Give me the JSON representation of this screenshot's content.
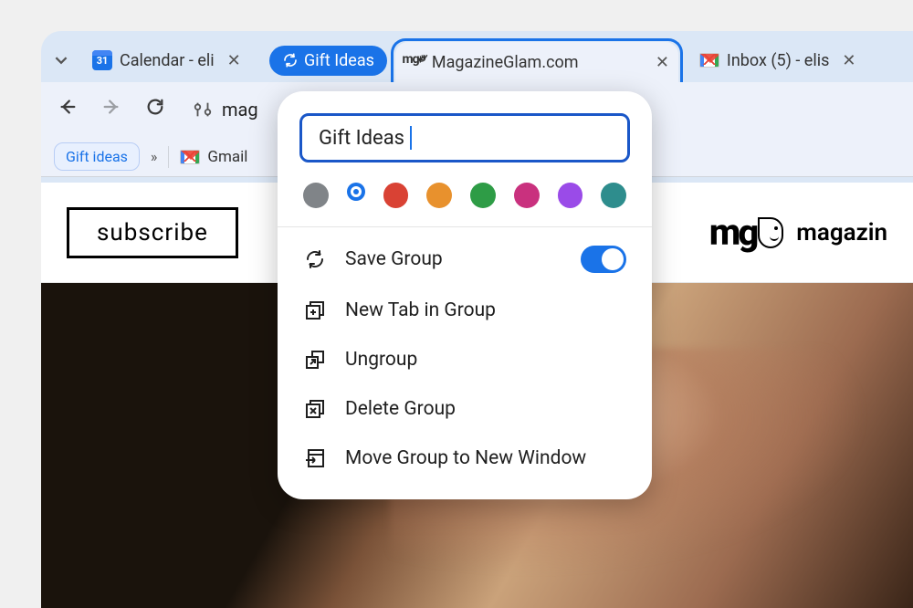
{
  "tabs": {
    "calendar_label": "Calendar - eli",
    "group_pill": "Gift Ideas",
    "magazine_label": "MagazineGlam.com",
    "inbox_label": "Inbox (5) - elis",
    "calendar_day": "31"
  },
  "toolbar": {
    "address_text": "mag"
  },
  "bookmarks": {
    "pill": "Gift ideas",
    "gmail_label": "Gmail"
  },
  "page": {
    "subscribe_label": "subscribe",
    "brand_text": "magazin",
    "brand_logo": "mg"
  },
  "popup": {
    "name_value": "Gift Ideas",
    "colors": [
      {
        "hex": "#808488"
      },
      {
        "hex": "#1a73e8",
        "selected": true
      },
      {
        "hex": "#d94234"
      },
      {
        "hex": "#e8912d"
      },
      {
        "hex": "#2e9c46"
      },
      {
        "hex": "#c9317e"
      },
      {
        "hex": "#9a4be8"
      },
      {
        "hex": "#2e8d8d"
      }
    ],
    "save_label": "Save Group",
    "newtab_label": "New Tab in Group",
    "ungroup_label": "Ungroup",
    "delete_label": "Delete Group",
    "move_label": "Move Group to New Window"
  }
}
